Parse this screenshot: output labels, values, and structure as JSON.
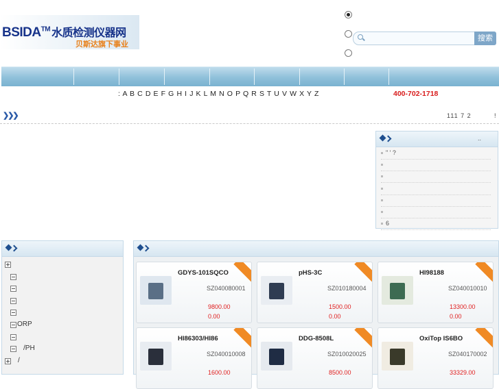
{
  "header": {
    "logo_text": "BSIDA",
    "logo_tm": "TM",
    "logo_cn": "水质检测仪器网",
    "logo_sub": "贝斯达旗下事业",
    "search_button": "搜索",
    "search_placeholder": ""
  },
  "alpha_index": ": A B C D E F G H I J K L M N O P Q R S T U V W X Y Z",
  "hotline": "400-702-1718",
  "crumb": {
    "stats": "111 7 2",
    "bang": "!"
  },
  "news_panel": {
    "more": "..",
    "items": [
      {
        "text": "\"   '      ?"
      },
      {
        "text": ""
      },
      {
        "text": ""
      },
      {
        "text": ""
      },
      {
        "text": ""
      },
      {
        "text": ""
      },
      {
        "text": "6"
      }
    ]
  },
  "categories": [
    {
      "text": "",
      "level": 0
    },
    {
      "text": "",
      "level": 1
    },
    {
      "text": "",
      "level": 1
    },
    {
      "text": "",
      "level": 1
    },
    {
      "text": "",
      "level": 1
    },
    {
      "text": "ORP",
      "level": 1
    },
    {
      "text": "",
      "level": 1
    },
    {
      "text": "/PH",
      "level": 1
    },
    {
      "text": "/",
      "level": 0
    }
  ],
  "products": [
    {
      "name": "GDYS-101SQCO",
      "code": "SZ040080001",
      "price": "9800.00",
      "price2": "0.00"
    },
    {
      "name": "pHS-3C",
      "code": "SZ010180004",
      "price": "1500.00",
      "price2": "0.00"
    },
    {
      "name": "HI98188",
      "code": "SZ040010010",
      "price": "13300.00",
      "price2": "0.00"
    },
    {
      "name": "HI86303/HI86",
      "code": "SZ040010008",
      "price": "1600.00",
      "price2": ""
    },
    {
      "name": "DDG-8508L",
      "code": "SZ010020025",
      "price": "8500.00",
      "price2": ""
    },
    {
      "name": "OxiTop IS6BO",
      "code": "SZ040170002",
      "price": "33329.00",
      "price2": ""
    }
  ],
  "colors": {
    "accent": "#17338a",
    "price": "#e02020",
    "hotline": "#d81c1c",
    "nav": "#8fc0da",
    "ribbon": "#f08a24"
  }
}
